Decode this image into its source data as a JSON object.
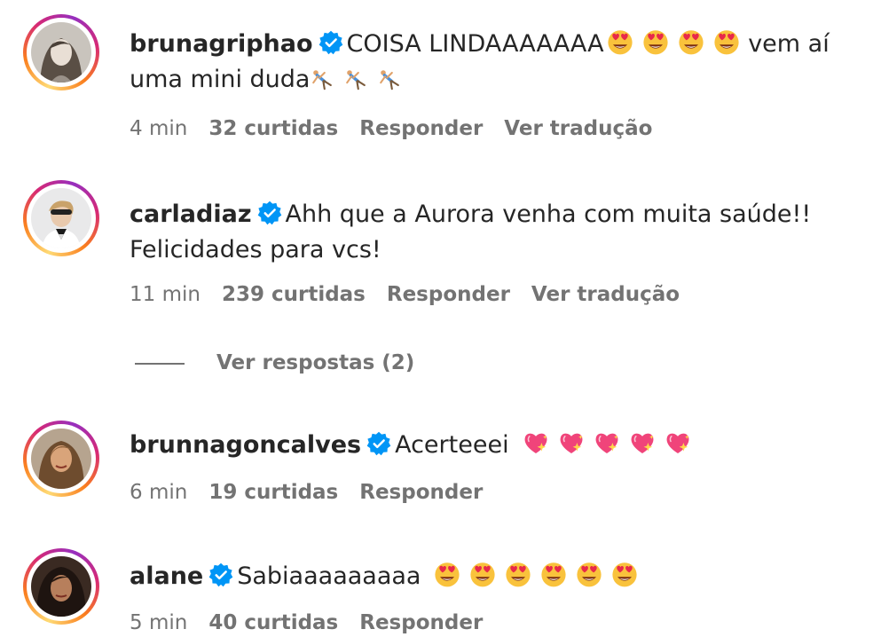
{
  "comments": [
    {
      "username": "brunagriphao",
      "text_before": "COISA LINDAAAAAAA",
      "text_after": " vem aí uma mini duda",
      "emoji_1": "smiling-face-with-heart-eyes",
      "emoji_2": "person-cartwheeling",
      "time": "4 min",
      "likes": "32 curtidas",
      "reply": "Responder",
      "translate": "Ver tradução"
    },
    {
      "username": "carladiaz",
      "text": "Ahh que a Aurora venha com muita saúde!! Felicidades para vcs!",
      "time": "11 min",
      "likes": "239 curtidas",
      "reply": "Responder",
      "translate": "Ver tradução",
      "view_replies": "Ver respostas (2)"
    },
    {
      "username": "brunnagoncalves",
      "text": "Acerteeei",
      "emoji": "sparkling-heart",
      "time": "6 min",
      "likes": "19 curtidas",
      "reply": "Responder"
    },
    {
      "username": "alane",
      "text": "Sabiaaaaaaaaa",
      "emoji": "smiling-face-with-heart-eyes",
      "time": "5 min",
      "likes": "40 curtidas",
      "reply": "Responder"
    }
  ],
  "colors": {
    "text": "#262626",
    "meta": "#737373",
    "verified": "#0095f6",
    "ring_start": "#feda75",
    "ring_mid": "#d62976",
    "ring_end": "#962fbf"
  }
}
